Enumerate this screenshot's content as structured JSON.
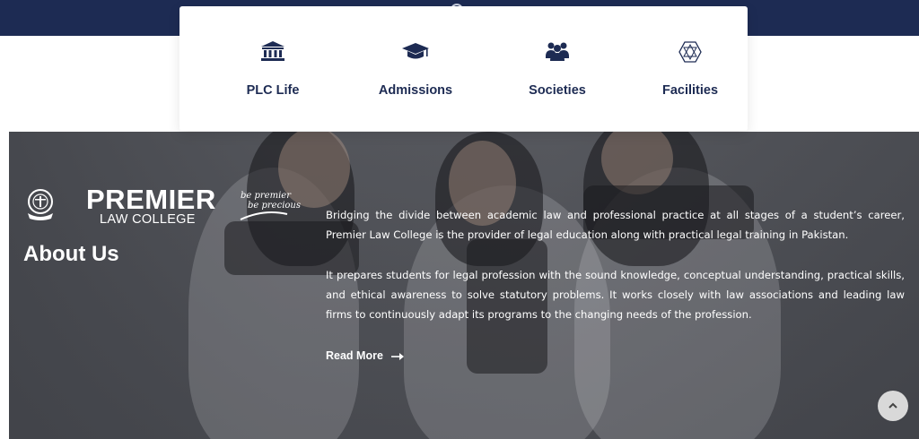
{
  "quick_links": [
    {
      "label": "PLC Life",
      "icon": "institution-icon"
    },
    {
      "label": "Admissions",
      "icon": "graduation-cap-icon"
    },
    {
      "label": "Societies",
      "icon": "group-icon"
    },
    {
      "label": "Facilities",
      "icon": "polyhedron-icon"
    }
  ],
  "logo": {
    "title": "PREMIER",
    "subtitle": "LAW COLLEGE",
    "tagline_line1": "be premier",
    "tagline_line2": "be precious"
  },
  "about": {
    "heading": "About Us",
    "paragraph_1": "Bridging the divide between academic law and professional practice at all stages of a student’s career, Premier Law College is the provider of legal education along with practical legal training in Pakistan.",
    "paragraph_2": "It prepares students for legal profession with the sound knowledge, conceptual understanding, practical skills, and ethical awareness to solve statutory problems. It works closely with law associations and leading law firms to continuously adapt its programs to the changing needs of the profession.",
    "read_more": "Read More"
  },
  "colors": {
    "navy": "#1d2b53",
    "overlay": "#45474d",
    "white": "#ffffff"
  }
}
